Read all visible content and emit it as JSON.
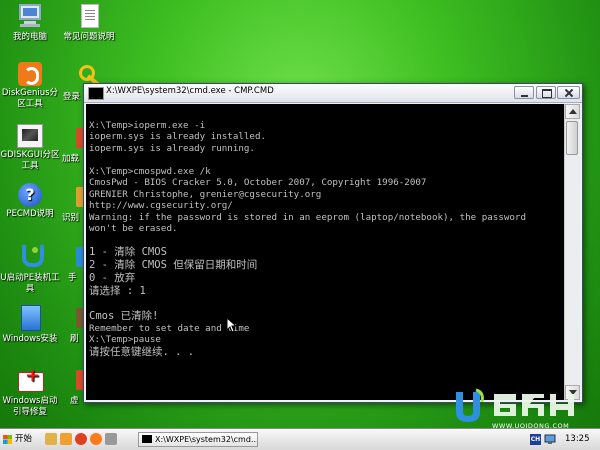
{
  "desktop": {
    "icons": [
      {
        "label": "我的电脑"
      },
      {
        "label": "常见问题说明"
      },
      {
        "label": "DiskGenius分区工具"
      },
      {
        "label": "登录"
      },
      {
        "label": "GDISKGUI分区工具"
      },
      {
        "label": "加载"
      },
      {
        "label": "PECMD说明"
      },
      {
        "label": "识别"
      },
      {
        "label": "U启动PE装机工具"
      },
      {
        "label": "手"
      },
      {
        "label": "Windows安装"
      },
      {
        "label": "刷"
      },
      {
        "label": "Windows启动引导修复"
      },
      {
        "label": "虚"
      }
    ]
  },
  "cmd_window": {
    "title": "X:\\WXPE\\system32\\cmd.exe - CMP.CMD",
    "lines": [
      "",
      "X:\\Temp>ioperm.exe -i",
      "ioperm.sys is already installed.",
      "ioperm.sys is already running.",
      "",
      "X:\\Temp>cmospwd.exe /k",
      "CmosPwd - BIOS Cracker 5.0, October 2007, Copyright 1996-2007",
      "GRENIER Christophe, grenier@cgsecurity.org",
      "http://www.cgsecurity.org/",
      "Warning: if the password is stored in an eeprom (laptop/notebook), the password",
      "won't be erased.",
      "",
      "1 - 清除 CMOS",
      "2 - 清除 CMOS 但保留日期和时间",
      "0 - 放弃",
      "请选择 : 1",
      "",
      "Cmos 已清除!",
      "Remember to set date and time",
      "X:\\Temp>pause",
      "请按任意键继续. . ."
    ]
  },
  "watermark": {
    "logo_text": "WWW.UQIDONG.COM"
  },
  "taskbar": {
    "start_label": "开始",
    "task_item_label": "X:\\WXPE\\system32\\cmd....",
    "tray_lang": "CH",
    "clock": "13:25"
  }
}
